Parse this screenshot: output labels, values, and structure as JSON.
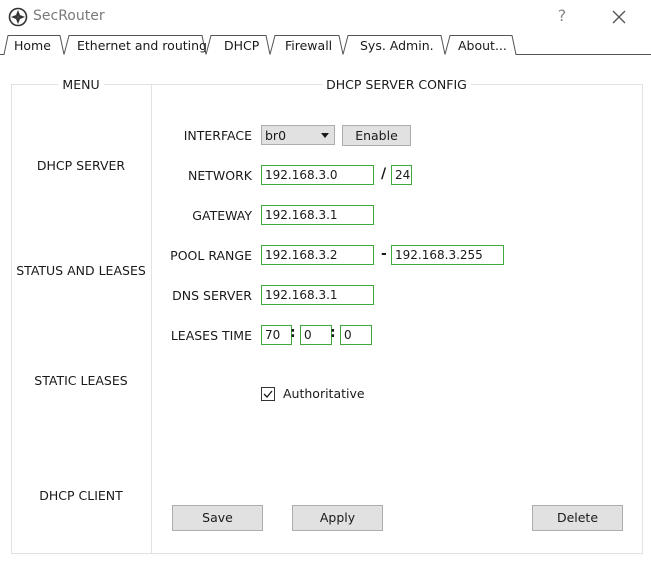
{
  "window": {
    "title": "SecRouter",
    "help_label": "?",
    "icons": {
      "app": "compass-icon",
      "close": "close-icon"
    }
  },
  "tabs": [
    {
      "label": "Home",
      "active": false
    },
    {
      "label": "Ethernet and routing",
      "active": false
    },
    {
      "label": "DHCP",
      "active": true
    },
    {
      "label": "Firewall",
      "active": false
    },
    {
      "label": "Sys. Admin.",
      "active": false
    },
    {
      "label": "About...",
      "active": false
    }
  ],
  "menu": {
    "header": "MENU",
    "items": [
      "DHCP SERVER",
      "STATUS AND LEASES",
      "STATIC LEASES",
      "DHCP CLIENT"
    ]
  },
  "config": {
    "header": "DHCP SERVER CONFIG",
    "interface": {
      "label": "INTERFACE",
      "value": "br0",
      "button": "Enable"
    },
    "network": {
      "label": "NETWORK",
      "address": "192.168.3.0",
      "separator": "/",
      "prefix": "24"
    },
    "gateway": {
      "label": "GATEWAY",
      "value": "192.168.3.1"
    },
    "pool_range": {
      "label": "POOL RANGE",
      "start": "192.168.3.2",
      "separator": "-",
      "end": "192.168.3.255"
    },
    "dns_server": {
      "label": "DNS SERVER",
      "value": "192.168.3.1"
    },
    "leases_time": {
      "label": "LEASES TIME",
      "days": "70",
      "hours": "0",
      "minutes": "0",
      "separator": ":"
    },
    "authoritative": {
      "label": "Authoritative",
      "checked": true
    }
  },
  "buttons": {
    "save": "Save",
    "apply": "Apply",
    "delete": "Delete"
  },
  "colors": {
    "field_border": "#3fa83f",
    "button_bg": "#e1e1e1",
    "panel_border": "#e2e2e2"
  }
}
